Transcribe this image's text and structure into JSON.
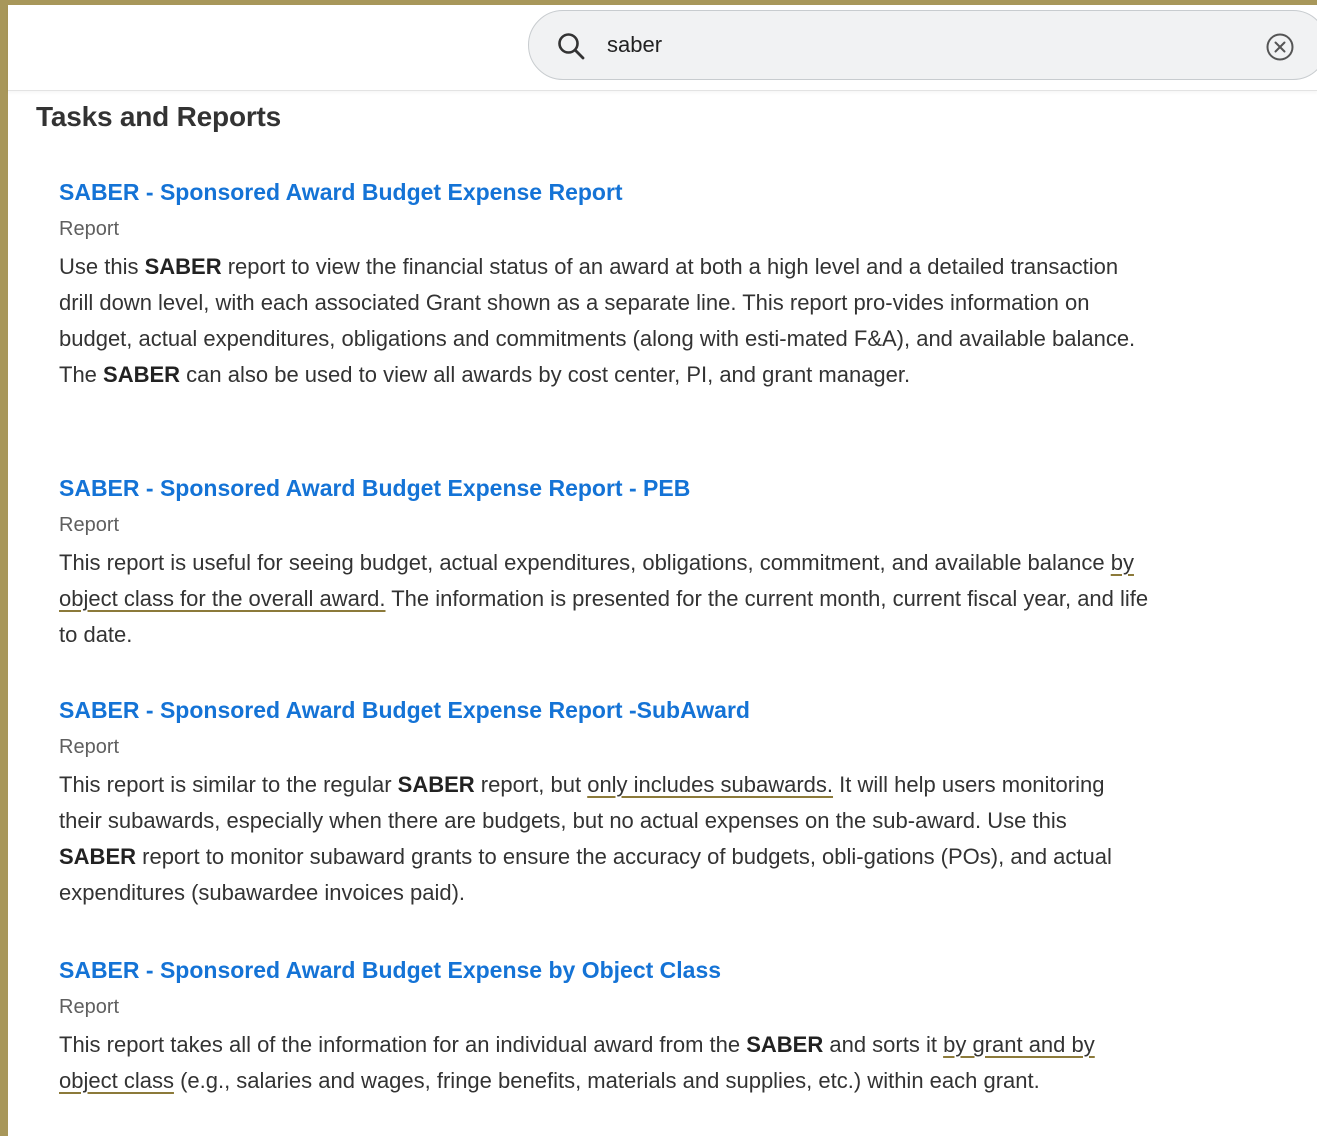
{
  "search": {
    "query": "saber"
  },
  "section_title": "Tasks and Reports",
  "results": [
    {
      "title": "SABER - Sponsored Award Budget Expense Report",
      "type": "Report",
      "description": [
        {
          "text": "Use this "
        },
        {
          "text": "SABER",
          "bold": true
        },
        {
          "text": " report to view the financial status of an award at both a high level and a detailed transaction drill down level, with each associated Grant shown as a separate line. This report pro-vides information on budget, actual expenditures, obligations and commitments (along with esti-mated F&A), and available balance. The "
        },
        {
          "text": "SABER",
          "bold": true
        },
        {
          "text": " can also be used to view all awards by cost center, PI, and grant manager."
        }
      ]
    },
    {
      "title": "SABER - Sponsored Award Budget Expense Report - PEB",
      "type": "Report",
      "description": [
        {
          "text": "This report is useful for seeing budget, actual expenditures, obligations, commitment, and available balance "
        },
        {
          "text": "by object class for the overall award.",
          "underline": true
        },
        {
          "text": " The information is presented for the current month, current fiscal year, and life to date."
        }
      ]
    },
    {
      "title": "SABER - Sponsored Award Budget Expense Report -SubAward",
      "type": "Report",
      "description": [
        {
          "text": "This report is similar to the regular "
        },
        {
          "text": "SABER",
          "bold": true
        },
        {
          "text": " report, but "
        },
        {
          "text": "only includes subawards.",
          "underline": true
        },
        {
          "text": " It will help users monitoring their subawards, especially when there are budgets, but no actual expenses on the sub-award. Use this "
        },
        {
          "text": "SABER",
          "bold": true
        },
        {
          "text": " report to monitor subaward grants to ensure the accuracy of budgets, obli-gations (POs), and actual expenditures (subawardee invoices paid)."
        }
      ]
    },
    {
      "title": "SABER - Sponsored Award Budget Expense by Object Class",
      "type": "Report",
      "description": [
        {
          "text": "This report takes all of the information for an individual award from the "
        },
        {
          "text": "SABER",
          "bold": true
        },
        {
          "text": " and sorts it "
        },
        {
          "text": "by grant and by object class",
          "underline": true
        },
        {
          "text": " (e.g., salaries and wages, fringe benefits, materials and supplies, etc.) within each grant."
        }
      ]
    }
  ]
}
